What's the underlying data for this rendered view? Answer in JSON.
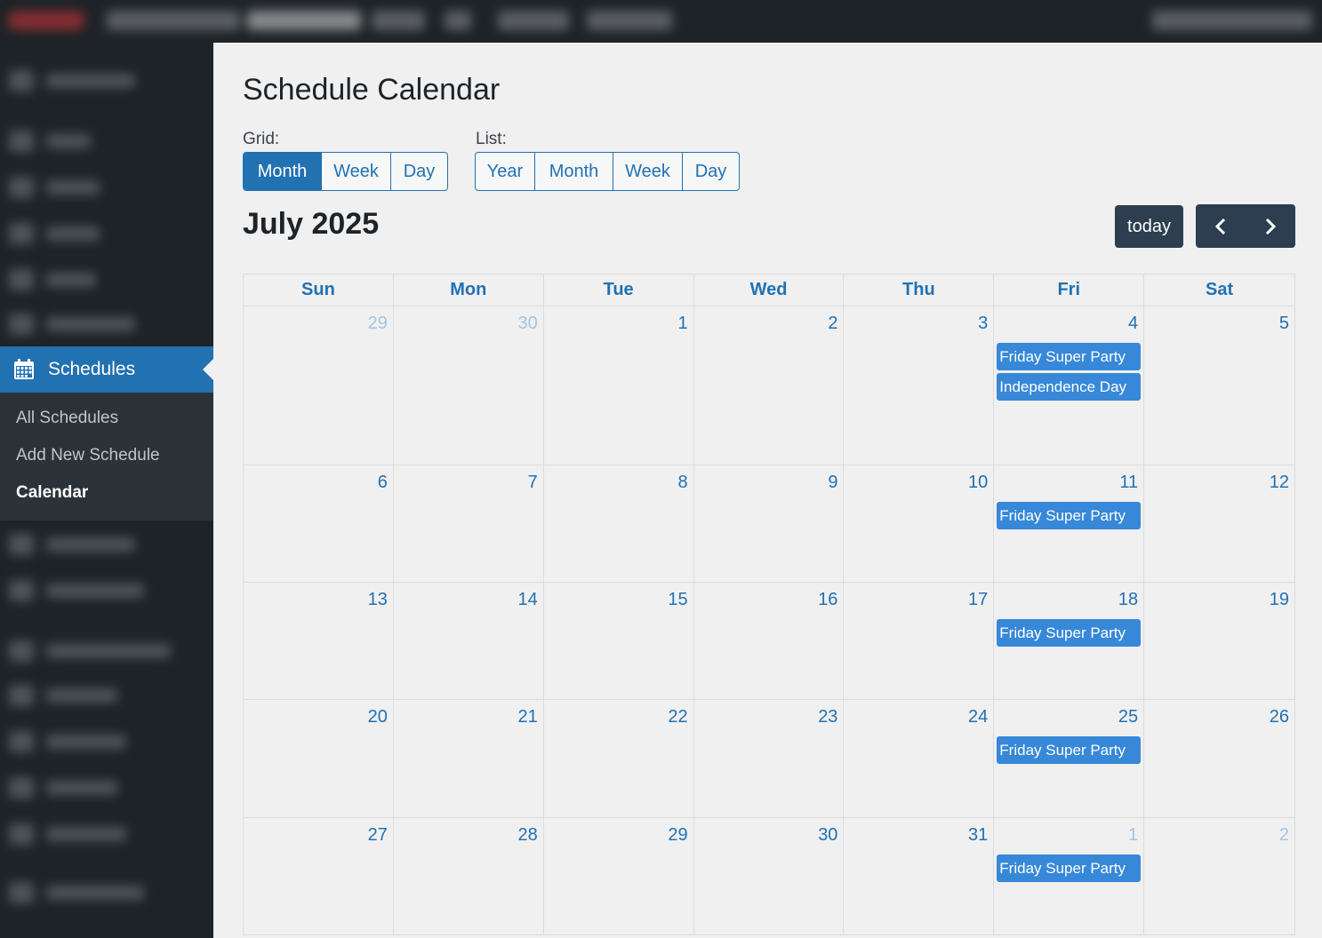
{
  "sidebar": {
    "active_item": {
      "label": "Schedules",
      "icon": "calendar-icon"
    },
    "submenu": [
      {
        "label": "All Schedules",
        "current": false
      },
      {
        "label": "Add New Schedule",
        "current": false
      },
      {
        "label": "Calendar",
        "current": true
      }
    ]
  },
  "page": {
    "title": "Schedule Calendar",
    "grid_label": "Grid:",
    "list_label": "List:",
    "grid_buttons": [
      "Month",
      "Week",
      "Day"
    ],
    "list_buttons": [
      "Year",
      "Month",
      "Week",
      "Day"
    ],
    "grid_active": "Month"
  },
  "calendar": {
    "title": "July 2025",
    "today_label": "today",
    "weekdays": [
      "Sun",
      "Mon",
      "Tue",
      "Wed",
      "Thu",
      "Fri",
      "Sat"
    ],
    "weeks": [
      [
        {
          "d": "29",
          "other": true
        },
        {
          "d": "30",
          "other": true
        },
        {
          "d": "1"
        },
        {
          "d": "2"
        },
        {
          "d": "3"
        },
        {
          "d": "4",
          "events": [
            "Friday Super Party",
            "Independence Day"
          ]
        },
        {
          "d": "5"
        }
      ],
      [
        {
          "d": "6"
        },
        {
          "d": "7"
        },
        {
          "d": "8"
        },
        {
          "d": "9"
        },
        {
          "d": "10"
        },
        {
          "d": "11",
          "events": [
            "Friday Super Party"
          ]
        },
        {
          "d": "12"
        }
      ],
      [
        {
          "d": "13"
        },
        {
          "d": "14"
        },
        {
          "d": "15"
        },
        {
          "d": "16"
        },
        {
          "d": "17"
        },
        {
          "d": "18",
          "events": [
            "Friday Super Party"
          ]
        },
        {
          "d": "19"
        }
      ],
      [
        {
          "d": "20"
        },
        {
          "d": "21"
        },
        {
          "d": "22"
        },
        {
          "d": "23"
        },
        {
          "d": "24"
        },
        {
          "d": "25",
          "events": [
            "Friday Super Party"
          ]
        },
        {
          "d": "26"
        }
      ],
      [
        {
          "d": "27"
        },
        {
          "d": "28"
        },
        {
          "d": "29"
        },
        {
          "d": "30"
        },
        {
          "d": "31"
        },
        {
          "d": "1",
          "other": true,
          "events": [
            "Friday Super Party"
          ]
        },
        {
          "d": "2",
          "other": true
        }
      ]
    ]
  },
  "colors": {
    "accent": "#2271b1",
    "event": "#3788d8",
    "toolbar_button": "#2c3e50",
    "sidebar": "#1d2327"
  }
}
